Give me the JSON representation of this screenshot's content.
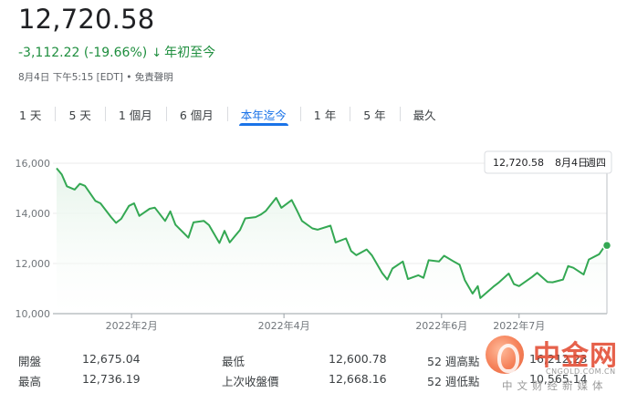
{
  "quote": {
    "price": "12,720.58",
    "change": "-3,112.22 (-19.66%)",
    "arrow": "↓",
    "period": "年初至今",
    "meta": "8月4日 下午5:15 [EDT] • 免責聲明"
  },
  "tabs": [
    {
      "label": "1 天",
      "active": false
    },
    {
      "label": "5 天",
      "active": false
    },
    {
      "label": "1 個月",
      "active": false
    },
    {
      "label": "6 個月",
      "active": false
    },
    {
      "label": "本年迄今",
      "active": true
    },
    {
      "label": "1 年",
      "active": false
    },
    {
      "label": "5 年",
      "active": false
    },
    {
      "label": "最久",
      "active": false
    }
  ],
  "tooltip": {
    "value": "12,720.58",
    "date": "8月4日",
    "weekday": "週四"
  },
  "colors": {
    "line": "#34a853",
    "fill_top": "#e6f4ea",
    "accent": "#1a73e8",
    "down": "#1e8e3e"
  },
  "chart_data": {
    "type": "area",
    "ylim": [
      10000,
      16000
    ],
    "yticks": [
      16000,
      14000,
      12000,
      10000
    ],
    "ytick_labels": [
      "16,000",
      "14,000",
      "12,000",
      "10,000"
    ],
    "xlim": [
      "2022-01-03",
      "2022-08-04"
    ],
    "xticks": [
      "2022-02-01",
      "2022-04-01",
      "2022-06-01",
      "2022-07-01"
    ],
    "xtick_labels": [
      "2022年2月",
      "2022年4月",
      "2022年6月",
      "2022年7月"
    ],
    "dates": [
      "2022-01-03",
      "2022-01-05",
      "2022-01-07",
      "2022-01-10",
      "2022-01-12",
      "2022-01-14",
      "2022-01-18",
      "2022-01-20",
      "2022-01-24",
      "2022-01-26",
      "2022-01-28",
      "2022-01-31",
      "2022-02-02",
      "2022-02-04",
      "2022-02-08",
      "2022-02-10",
      "2022-02-14",
      "2022-02-16",
      "2022-02-18",
      "2022-02-23",
      "2022-02-25",
      "2022-03-01",
      "2022-03-03",
      "2022-03-07",
      "2022-03-09",
      "2022-03-11",
      "2022-03-15",
      "2022-03-17",
      "2022-03-21",
      "2022-03-23",
      "2022-03-25",
      "2022-03-29",
      "2022-03-31",
      "2022-04-04",
      "2022-04-06",
      "2022-04-08",
      "2022-04-12",
      "2022-04-14",
      "2022-04-19",
      "2022-04-21",
      "2022-04-25",
      "2022-04-27",
      "2022-04-29",
      "2022-05-03",
      "2022-05-05",
      "2022-05-09",
      "2022-05-11",
      "2022-05-13",
      "2022-05-17",
      "2022-05-19",
      "2022-05-23",
      "2022-05-25",
      "2022-05-27",
      "2022-05-31",
      "2022-06-02",
      "2022-06-06",
      "2022-06-08",
      "2022-06-10",
      "2022-06-13",
      "2022-06-15",
      "2022-06-16",
      "2022-06-21",
      "2022-06-23",
      "2022-06-27",
      "2022-06-29",
      "2022-07-01",
      "2022-07-06",
      "2022-07-08",
      "2022-07-12",
      "2022-07-14",
      "2022-07-18",
      "2022-07-20",
      "2022-07-22",
      "2022-07-26",
      "2022-07-28",
      "2022-08-01",
      "2022-08-03",
      "2022-08-04"
    ],
    "values": [
      15800,
      15550,
      15080,
      14950,
      15180,
      15100,
      14500,
      14400,
      13860,
      13620,
      13780,
      14300,
      14400,
      13900,
      14180,
      14230,
      13700,
      14080,
      13550,
      13030,
      13640,
      13700,
      13530,
      12820,
      13300,
      12840,
      13340,
      13800,
      13850,
      13950,
      14100,
      14620,
      14220,
      14530,
      14120,
      13700,
      13400,
      13350,
      13510,
      12840,
      13000,
      12500,
      12330,
      12560,
      12330,
      11620,
      11360,
      11800,
      12080,
      11380,
      11530,
      11430,
      12130,
      12080,
      12310,
      12060,
      11950,
      11340,
      10800,
      11100,
      10620,
      11070,
      11230,
      11600,
      11180,
      11100,
      11460,
      11630,
      11260,
      11250,
      11360,
      11900,
      11830,
      11560,
      12160,
      12370,
      12670,
      12720.58
    ]
  },
  "stats": [
    {
      "label": "開盤",
      "value": "12,675.04"
    },
    {
      "label": "最高",
      "value": "12,736.19"
    },
    {
      "label": "最低",
      "value": "12,600.78"
    },
    {
      "label": "上次收盤價",
      "value": "12,668.16"
    },
    {
      "label": "52 週高點",
      "value": "16,212.23"
    },
    {
      "label": "52 週低點",
      "value": "10,565.14"
    }
  ],
  "watermark": {
    "name": "中金网",
    "url": "CNGOLD.COM.CN",
    "tagline": "中文财经新媒体"
  }
}
